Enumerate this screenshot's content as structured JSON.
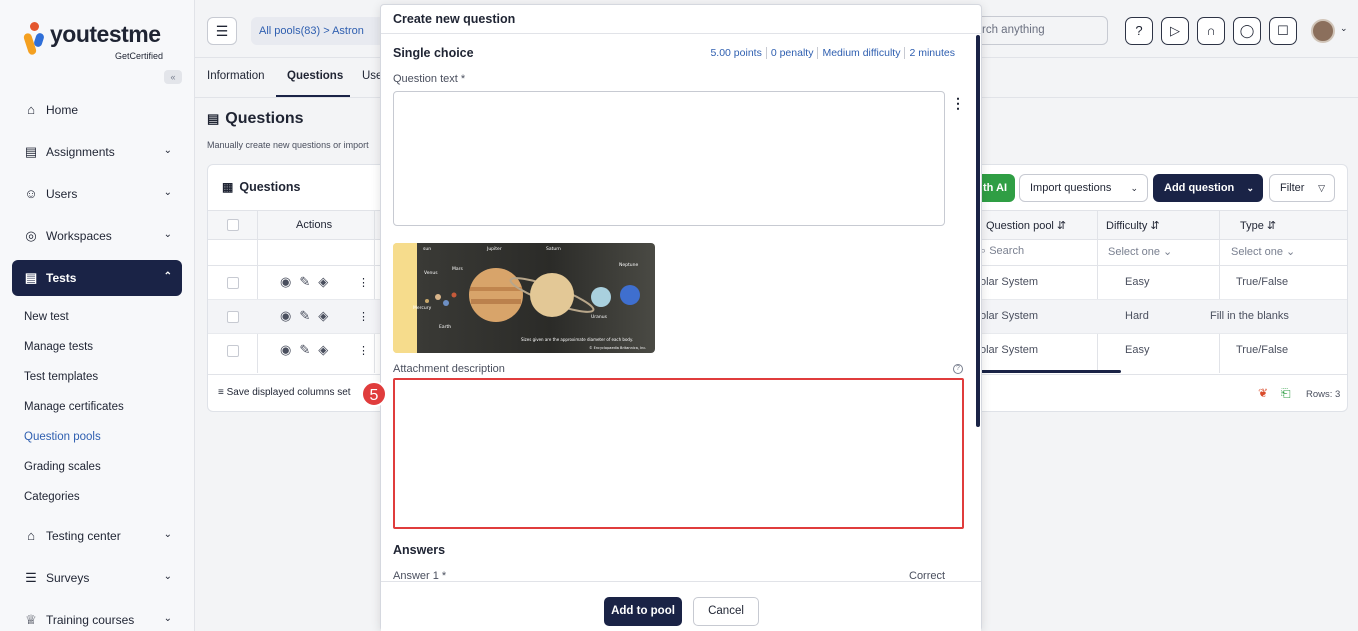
{
  "brand": {
    "name": "youtestme",
    "tagline": "GetCertified",
    "collapse_glyph": "«"
  },
  "sidebar": {
    "items": [
      {
        "label": "Home",
        "icon": "home-icon",
        "glyph": "⌂",
        "chevron": ""
      },
      {
        "label": "Assignments",
        "icon": "clipboard-icon",
        "glyph": "▤",
        "chevron": "⌄"
      },
      {
        "label": "Users",
        "icon": "users-icon",
        "glyph": "☺",
        "chevron": "⌄"
      },
      {
        "label": "Workspaces",
        "icon": "globe-icon",
        "glyph": "◎",
        "chevron": "⌄"
      },
      {
        "label": "Tests",
        "icon": "tests-icon",
        "glyph": "▤",
        "chevron": "⌃"
      }
    ],
    "test_subitems": [
      "New test",
      "Manage tests",
      "Test templates",
      "Manage certificates",
      "Question pools",
      "Grading scales",
      "Categories"
    ],
    "lower_items": [
      {
        "label": "Testing center",
        "icon": "graduation-cap-icon",
        "glyph": "⌂",
        "chevron": "⌄"
      },
      {
        "label": "Surveys",
        "icon": "list-icon",
        "glyph": "☰",
        "chevron": "⌄"
      },
      {
        "label": "Training courses",
        "icon": "trophy-icon",
        "glyph": "♕",
        "chevron": "⌄"
      }
    ]
  },
  "header": {
    "menu_glyph": "☰",
    "breadcrumb": "All pools(83)  >  Astron",
    "search_text": "rch anything",
    "icons": [
      {
        "name": "help-icon",
        "glyph": "?"
      },
      {
        "name": "play-icon",
        "glyph": "▷"
      },
      {
        "name": "headset-icon",
        "glyph": "∩"
      },
      {
        "name": "chat-icon",
        "glyph": "◯"
      },
      {
        "name": "bell-icon",
        "glyph": "☐"
      }
    ],
    "avatar_chevron": "⌄"
  },
  "tabs": [
    "Information",
    "Questions",
    "Use"
  ],
  "page": {
    "title": "Questions",
    "title_glyph": "▤",
    "description": "Manually create new questions or import"
  },
  "questions_card": {
    "title": "Questions",
    "title_glyph": "▦",
    "ai_button": "th AI",
    "import_button": "Import questions",
    "add_button": "Add question",
    "filter_button": "Filter",
    "chevron": "⌄",
    "filter_glyph": "▽",
    "columns": [
      "Actions",
      "Question pool ⇵",
      "Difficulty ⇵",
      "Type ⇵"
    ],
    "filters": [
      "⌕ Search",
      "Select one ⌄",
      "Select one ⌄"
    ],
    "action_glyphs": "◉✎◈",
    "kebab": "⋮",
    "rows": [
      {
        "pool": "olar System",
        "difficulty": "Easy",
        "type": "True/False"
      },
      {
        "pool": "olar System",
        "difficulty": "Hard",
        "type": "Fill in the blanks"
      },
      {
        "pool": "olar System",
        "difficulty": "Easy",
        "type": "True/False"
      }
    ],
    "save_columns": "Save displayed columns set",
    "save_glyph": "≡",
    "rows_count": "Rows: 3",
    "pdf_glyph": "❦",
    "excel_glyph": "⎗"
  },
  "modal": {
    "title": "Create new question",
    "question_type": "Single choice",
    "meta": [
      "5.00 points",
      "0 penalty",
      "Medium difficulty",
      "2 minutes"
    ],
    "question_text_label": "Question text *",
    "kebab": "⋮",
    "attachment_description_label": "Attachment description",
    "info_glyph": "?",
    "answers_title": "Answers",
    "answer_1_label": "Answer 1 *",
    "correct_label": "Correct",
    "add_to_pool": "Add to pool",
    "cancel": "Cancel",
    "image_caption": "Sizes given are the approximate diameter of each body.",
    "image_credit": "© Encyclopaedia Britannica, Inc.",
    "image_labels": {
      "sun": "sun\n(865,000 mi\n1,392,000 km)",
      "venus": "Venus\n(7,500 mi\n12,100 km)",
      "mars": "Mars\n(4,200 mi\n6,800 km)",
      "jupiter": "Jupiter\n(89,000 mi\n143,000 km)",
      "saturn": "Saturn\n(74,900 mi\n120,600 km)",
      "neptune": "Neptune\n(31,000 mi\n50,000 km)",
      "mercury": "Mercury\n(3,000 mi\n4,900 km)",
      "earth": "Earth\n(7,930 mi\n12,760 km)",
      "uranus": "Uranus\n(32,000 mi\n51,000 km)"
    }
  },
  "step_badge": "5"
}
